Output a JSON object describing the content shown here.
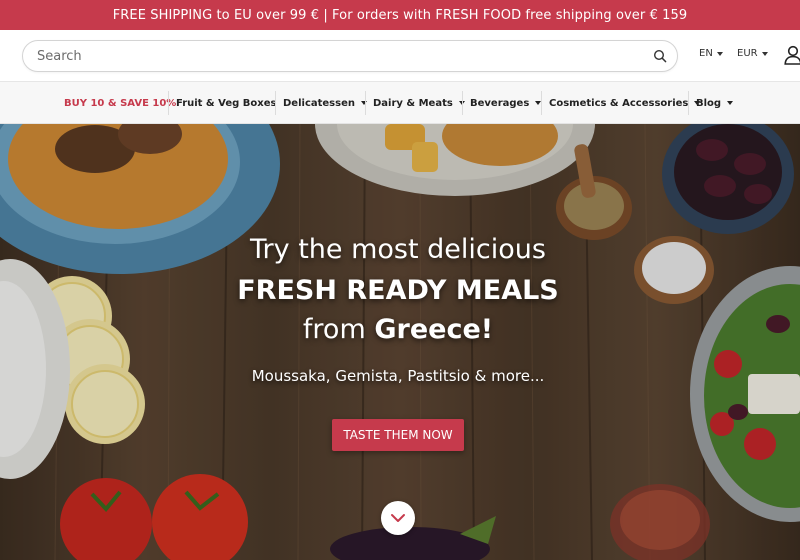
{
  "announcement": "FREE SHIPPING to EU over 99 € | For orders with FRESH FOOD free shipping over € 159",
  "header": {
    "search_placeholder": "Search",
    "language": "EN",
    "currency": "EUR",
    "icons": {
      "search": "search-icon",
      "user": "user-icon"
    }
  },
  "nav": {
    "items": [
      {
        "label": "BUY 10 & SAVE 10%",
        "dropdown": false
      },
      {
        "label": "Fruit & Veg Boxes",
        "dropdown": false
      },
      {
        "label": "Delicatessen",
        "dropdown": true
      },
      {
        "label": "Dairy & Meats",
        "dropdown": true
      },
      {
        "label": "Beverages",
        "dropdown": true
      },
      {
        "label": "Cosmetics & Accessories",
        "dropdown": true
      },
      {
        "label": "Blog",
        "dropdown": true
      }
    ]
  },
  "hero": {
    "line1": "Try the most delicious",
    "line2": "FRESH READY MEALS",
    "line3_prefix": "from ",
    "line3_bold": "Greece!",
    "subtitle": "Moussaka, Gemista, Pastitsio & more...",
    "cta": "TASTE THEM NOW",
    "scroll_icon": "chevron-down-icon"
  },
  "colors": {
    "brand": "#c63a4c",
    "nav_bg": "#f7f7f7"
  }
}
